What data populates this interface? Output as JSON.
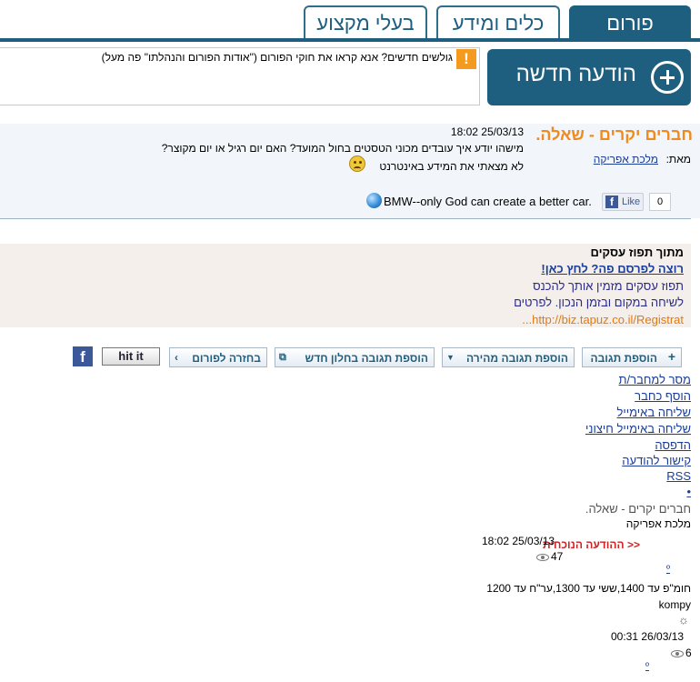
{
  "tabs": [
    {
      "label": "פורום",
      "active": true
    },
    {
      "label": "כלים ומידע",
      "active": false
    },
    {
      "label": "בעלי מקצוע",
      "active": false
    }
  ],
  "notice": {
    "icon_text": "!",
    "text": "גולשים חדשים? אנא קראו את חוקי הפורום (\"אודות הפורום והנהלתו\" פה מעל)"
  },
  "new_message": {
    "label": "הודעה חדשה"
  },
  "post": {
    "title": "חברים יקרים - שאלה.",
    "date": "18:02 25/03/13",
    "body_line1": "מישהו יודע איך עובדים מכוני הטסטים בחול המועד? האם יום רגיל או יום מקוצר?",
    "body_line2": "לא מצאתי את המידע באינטרנט",
    "from_label": "מאת:",
    "author": "מלכת אפריקה",
    "signature": "BMW--only God can create a better car.",
    "like_label": "Like",
    "like_count": "0"
  },
  "ad": {
    "title": "מתוך תפוז עסקים",
    "link": "רוצה לפרסם פה? לחץ כאן!",
    "line1": "תפוז עסקים מזמין אותך להכנס",
    "line2": "לשיחה במקום ובזמן הנכון. לפרטים",
    "url": "...http://biz.tapuz.co.il/Registrat"
  },
  "actions": {
    "add_reply": "הוספת תגובה",
    "quick_reply": "הוספת תגובה מהירה",
    "new_window_reply": "הוספת תגובה בחלון חדש",
    "back_to_forum": "בחזרה לפורום",
    "hit_it": "hit it",
    "facebook": "f"
  },
  "links": [
    "מסר למחבר/ת",
    "הוסף כחבר",
    "שליחה באימייל",
    "שליחה באימייל חיצוני",
    "הדפסה",
    "קישור להודעה",
    "RSS",
    "•"
  ],
  "thread": {
    "title": "חברים יקרים - שאלה.",
    "author": "מלכת אפריקה",
    "current_label": "<< ההודעה הנוכחית",
    "msg1": {
      "date": "18:02 25/03/13",
      "views": "47",
      "link": "º"
    },
    "reply_text": "חומ\"פ עד 1400,ששי עד 1300,ער\"ח עד 1200",
    "reply_author": "kompy",
    "reply_icon": "☼",
    "msg2": {
      "date": "00:31 26/03/13",
      "views": "6",
      "link": "º"
    }
  }
}
